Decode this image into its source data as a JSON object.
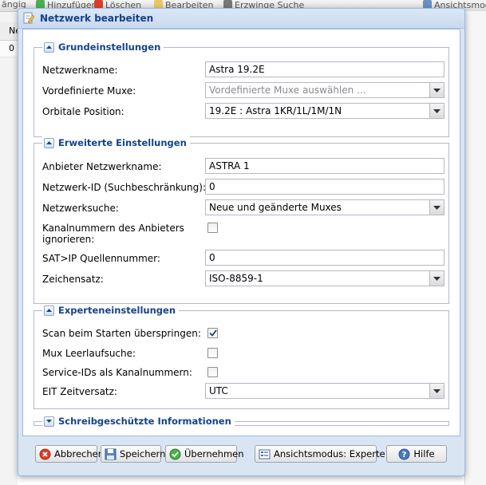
{
  "background": {
    "toolbar_items": [
      "ängig",
      "Hinzufügen",
      "Löschen",
      "Bearbeiten",
      "Erzwinge Suche",
      "Ansichtsmod"
    ],
    "grid_header": "Ne",
    "grid_row": "0"
  },
  "dialog": {
    "title": "Netzwerk bearbeiten",
    "sections": {
      "basic": {
        "legend": "Grundeinstellungen",
        "network_name_label": "Netzwerkname:",
        "network_name_value": "Astra 19.2E",
        "predefined_muxes_label": "Vordefinierte Muxe:",
        "predefined_muxes_placeholder": "Vordefinierte Muxe auswählen ...",
        "orbital_position_label": "Orbitale Position:",
        "orbital_position_value": "19.2E : Astra 1KR/1L/1M/1N"
      },
      "advanced": {
        "legend": "Erweiterte Einstellungen",
        "provider_name_label": "Anbieter Netzwerkname:",
        "provider_name_value": "ASTRA 1",
        "network_id_label": "Netzwerk-ID (Suchbeschränkung):",
        "network_id_value": "0",
        "network_discovery_label": "Netzwerksuche:",
        "network_discovery_value": "Neue und geänderte Muxes",
        "ignore_provider_numbers_label_line1": "Kanalnummern des Anbieters",
        "ignore_provider_numbers_label_line2": "ignorieren:",
        "ignore_provider_numbers_checked": false,
        "satip_source_label": "SAT>IP Quellennummer:",
        "satip_source_value": "0",
        "charset_label": "Zeichensatz:",
        "charset_value": "ISO-8859-1"
      },
      "expert": {
        "legend": "Experteneinstellungen",
        "skip_scan_label": "Scan beim Starten überspringen:",
        "skip_scan_checked": true,
        "idle_scan_label": "Mux Leerlaufsuche:",
        "idle_scan_checked": false,
        "sid_as_channel_label": "Service-IDs als Kanalnummern:",
        "sid_as_channel_checked": false,
        "eit_offset_label": "EIT Zeitversatz:",
        "eit_offset_value": "UTC"
      },
      "readonly": {
        "legend": "Schreibgeschützte Informationen"
      }
    },
    "buttons": {
      "cancel": "Abbrechen",
      "save": "Speichern",
      "apply": "Übernehmen",
      "view_mode": "Ansichtsmodus: Experte",
      "help": "Hilfe"
    }
  },
  "colors": {
    "title_text": "#15428b",
    "dialog_frame": "#99bbe8",
    "dialog_bg": "#d9e5f3"
  }
}
